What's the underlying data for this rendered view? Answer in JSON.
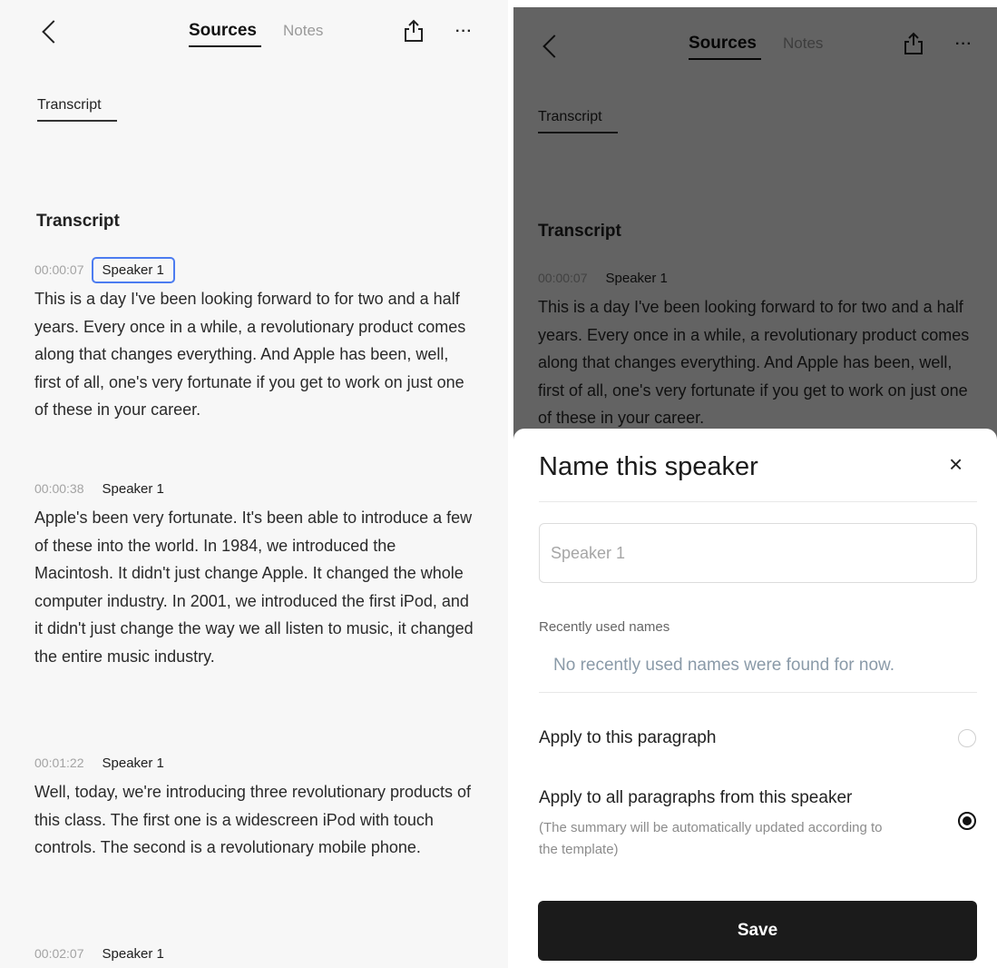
{
  "header": {
    "tab_sources": "Sources",
    "tab_notes": "Notes",
    "more": "···"
  },
  "sub_tab": "Transcript",
  "section_title": "Transcript",
  "entries": [
    {
      "timestamp": "00:00:07",
      "speaker": "Speaker 1",
      "text": "This is a day I've been looking forward to for two and a half years. Every once in a while, a revolutionary product comes along that changes everything. And Apple has been, well, first of all, one's very fortunate if you get to work on just one of these in your career."
    },
    {
      "timestamp": "00:00:38",
      "speaker": "Speaker 1",
      "text": "Apple's been very fortunate. It's been able to introduce a few of these into the world. In 1984, we introduced the Macintosh. It didn't just change Apple. It changed the whole computer industry. In 2001, we introduced the first iPod, and it didn't just change the way we all listen to music, it changed the entire music industry."
    },
    {
      "timestamp": "00:01:22",
      "speaker": "Speaker 1",
      "text": "Well, today, we're introducing three revolutionary products of this class. The first one is a widescreen iPod with touch controls. The second is a revolutionary mobile phone."
    },
    {
      "timestamp": "00:02:07",
      "speaker": "Speaker 1",
      "text": ""
    }
  ],
  "dialog": {
    "title": "Name this speaker",
    "close": "×",
    "input_placeholder": "Speaker 1",
    "recent_label": "Recently used names",
    "recent_empty": "No recently used names were found for now.",
    "option1_label": "Apply to this paragraph",
    "option2_label": "Apply to all paragraphs from this speaker",
    "option2_desc": "(The summary will be automatically updated according to the template)",
    "selected_option": 2,
    "save_label": "Save"
  },
  "colors": {
    "highlight_border": "#4c7cf0",
    "save_bg": "#1b1b1b",
    "overlay": "rgba(0,0,0,0.6)"
  }
}
